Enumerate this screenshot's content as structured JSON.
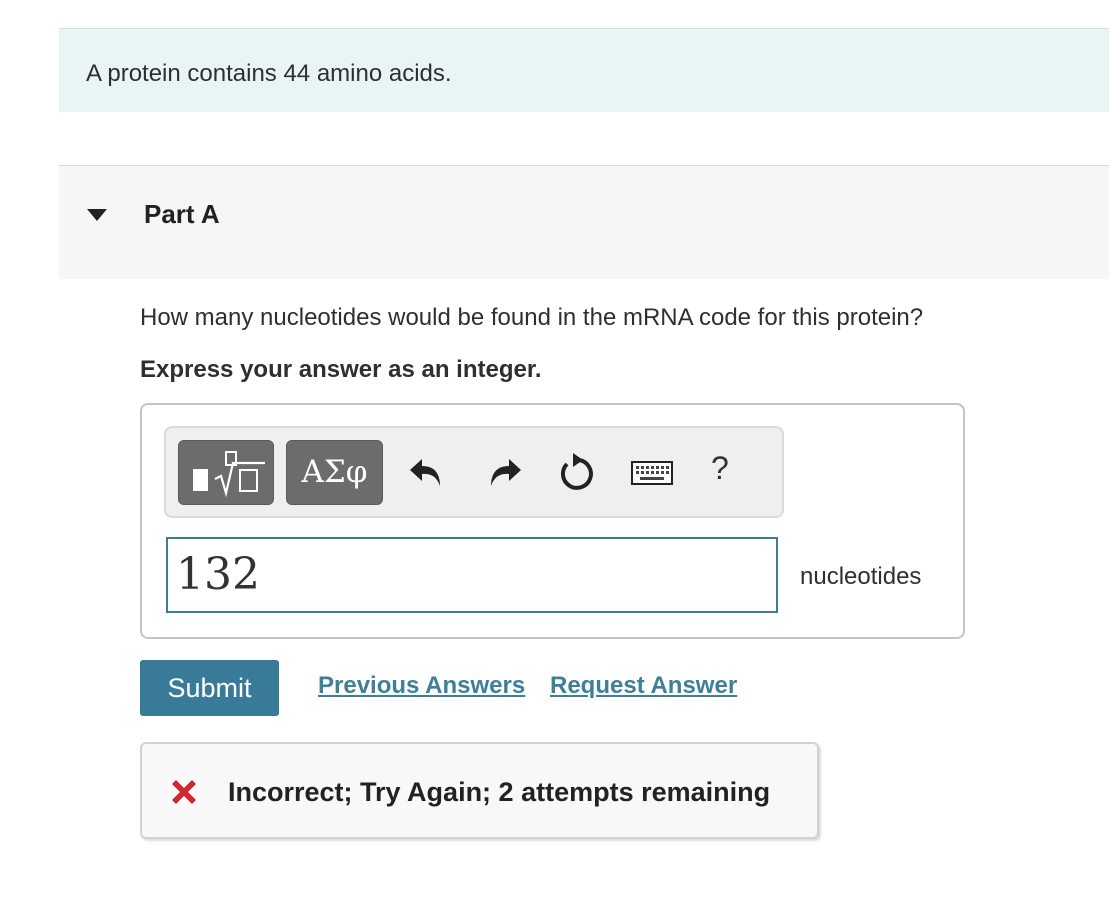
{
  "intro": {
    "text": "A protein contains 44 amino acids."
  },
  "part": {
    "title": "Part A",
    "expanded": true
  },
  "question": {
    "prompt": "How many nucleotides would be found in the mRNA code for this protein?",
    "instruction": "Express your answer as an integer."
  },
  "toolbar": {
    "greek_label": "ΑΣφ",
    "help_label": "?",
    "icons": [
      "templates-icon",
      "undo-icon",
      "redo-icon",
      "reset-icon",
      "keyboard-icon",
      "help-icon"
    ]
  },
  "answer": {
    "value": "132",
    "unit": "nucleotides"
  },
  "actions": {
    "submit_label": "Submit",
    "previous_answers_label": "Previous Answers",
    "request_answer_label": "Request Answer"
  },
  "feedback": {
    "status": "incorrect",
    "message": "Incorrect; Try Again; 2 attempts remaining"
  },
  "colors": {
    "intro_bg": "#e9f5f5",
    "accent": "#3a7a99",
    "link": "#3e7f9a",
    "error": "#d0282e"
  }
}
